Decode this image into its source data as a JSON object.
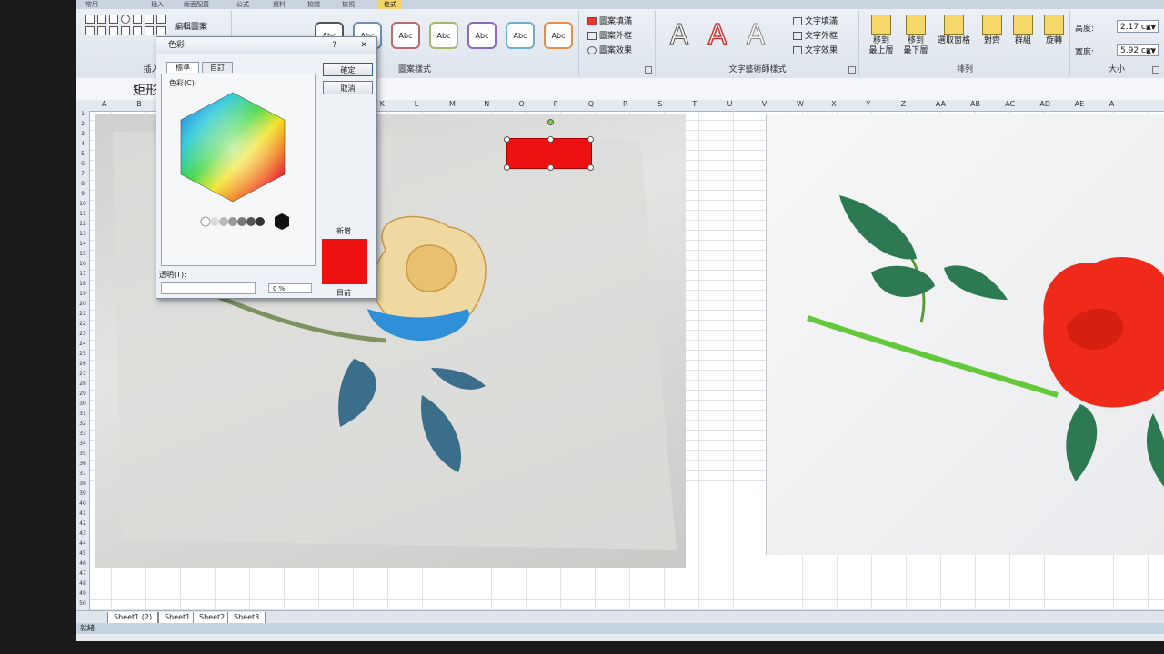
{
  "ribbon": {
    "tabs": [
      {
        "label": "常用"
      },
      {
        "label": "插入"
      },
      {
        "label": "版面配置"
      },
      {
        "label": "公式"
      },
      {
        "label": "資料"
      },
      {
        "label": "校閱"
      },
      {
        "label": "檢視"
      },
      {
        "label": "格式"
      }
    ],
    "insert_shapes_label": "插入圖",
    "edit_shape_label": "編輯圖案",
    "shape_styles_label": "圖案樣式",
    "shape_style_abc": "Abc",
    "fill_label": "圖案填滿",
    "outline_label": "圖案外框",
    "effects_label": "圖案效果",
    "wordart_label": "文字藝術師樣式",
    "text_fill_label": "文字填滿",
    "text_outline_label": "文字外框",
    "text_effects_label": "文字效果",
    "arrange_label": "排列",
    "bring_forward_label": "移到\n最上層",
    "send_back_label": "移到\n最下層",
    "selection_pane_label": "選取窗格",
    "align_label": "對齊",
    "group_label": "群組",
    "rotate_label": "旋轉",
    "size_label": "大小",
    "height_label": "高度:",
    "height_value": "2.17 cm",
    "width_label": "寬度:",
    "width_value": "5.92 cm"
  },
  "name_box": "矩形",
  "columns": [
    "A",
    "B",
    "",
    "",
    "",
    "",
    "",
    "J",
    "K",
    "L",
    "M",
    "N",
    "O",
    "P",
    "Q",
    "R",
    "S",
    "T",
    "U",
    "V",
    "W",
    "X",
    "Y",
    "Z",
    "AA",
    "AB",
    "AC",
    "AD",
    "AE",
    "A"
  ],
  "rows": [
    "1",
    "2",
    "3",
    "4",
    "5",
    "6",
    "7",
    "8",
    "9",
    "10",
    "11",
    "12",
    "13",
    "14",
    "15",
    "16",
    "17",
    "18",
    "19",
    "20",
    "21",
    "22",
    "23",
    "24",
    "25",
    "26",
    "27",
    "28",
    "29",
    "30",
    "31",
    "32",
    "33",
    "34",
    "35",
    "36",
    "37",
    "38",
    "39",
    "40",
    "41",
    "42",
    "43",
    "44",
    "45",
    "46",
    "47",
    "48",
    "49",
    "50"
  ],
  "dialog": {
    "title": "色彩",
    "help": "?",
    "close": "✕",
    "tab_standard": "標準",
    "tab_custom": "自訂",
    "ok": "確定",
    "cancel": "取消",
    "colors_label": "色彩(C):",
    "new_label": "新增",
    "current_label": "目前",
    "transparency_label": "透明(T):",
    "transparency_value": "0 %"
  },
  "sheet_tabs": [
    "Sheet1 (2)",
    "Sheet1",
    "Sheet2",
    "Sheet3"
  ],
  "status_text": "就緒",
  "colors": {
    "selected_fill": "#ee1111",
    "accent_tab": "#f3d36a"
  }
}
